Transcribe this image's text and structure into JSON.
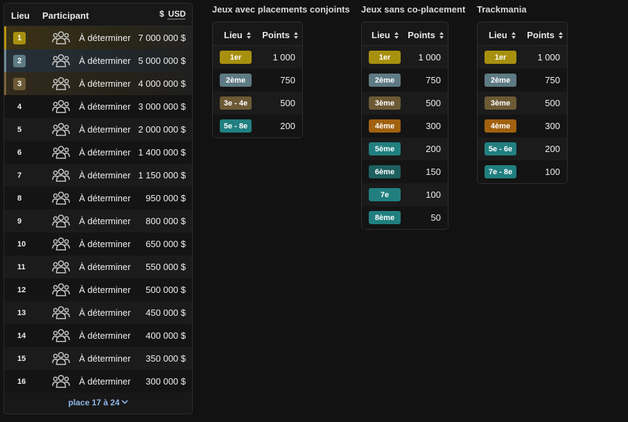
{
  "prize_table": {
    "headers": {
      "place": "Lieu",
      "participant": "Participant",
      "currency_symbol": "$",
      "currency_code": "USD"
    },
    "rows": [
      {
        "place": "1",
        "participant": "À déterminer",
        "amount": "7 000 000 $",
        "medal": "gold"
      },
      {
        "place": "2",
        "participant": "À déterminer",
        "amount": "5 000 000 $",
        "medal": "silver"
      },
      {
        "place": "3",
        "participant": "À déterminer",
        "amount": "4 000 000 $",
        "medal": "bronze"
      },
      {
        "place": "4",
        "participant": "À déterminer",
        "amount": "3 000 000 $",
        "medal": ""
      },
      {
        "place": "5",
        "participant": "À déterminer",
        "amount": "2 000 000 $",
        "medal": ""
      },
      {
        "place": "6",
        "participant": "À déterminer",
        "amount": "1 400 000 $",
        "medal": ""
      },
      {
        "place": "7",
        "participant": "À déterminer",
        "amount": "1 150 000 $",
        "medal": ""
      },
      {
        "place": "8",
        "participant": "À déterminer",
        "amount": "950 000 $",
        "medal": ""
      },
      {
        "place": "9",
        "participant": "À déterminer",
        "amount": "800 000 $",
        "medal": ""
      },
      {
        "place": "10",
        "participant": "À déterminer",
        "amount": "650 000 $",
        "medal": ""
      },
      {
        "place": "11",
        "participant": "À déterminer",
        "amount": "550 000 $",
        "medal": ""
      },
      {
        "place": "12",
        "participant": "À déterminer",
        "amount": "500 000 $",
        "medal": ""
      },
      {
        "place": "13",
        "participant": "À déterminer",
        "amount": "450 000 $",
        "medal": ""
      },
      {
        "place": "14",
        "participant": "À déterminer",
        "amount": "400 000 $",
        "medal": ""
      },
      {
        "place": "15",
        "participant": "À déterminer",
        "amount": "350 000 $",
        "medal": ""
      },
      {
        "place": "16",
        "participant": "À déterminer",
        "amount": "300 000 $",
        "medal": ""
      }
    ],
    "show_more": "place 17 à 24",
    "participant_icon": "group-icon",
    "expand_icon": "chevron-down-icon"
  },
  "points_tables": [
    {
      "title": "Jeux avec placements conjoints",
      "headers": {
        "place": "Lieu",
        "points": "Points"
      },
      "rows": [
        {
          "place": "1er",
          "points": "1 000",
          "color": "#a8900f"
        },
        {
          "place": "2ème",
          "points": "750",
          "color": "#5e7a84"
        },
        {
          "place": "3e - 4e",
          "points": "500",
          "color": "#6d5a35"
        },
        {
          "place": "5e - 8e",
          "points": "200",
          "color": "#217f80"
        }
      ]
    },
    {
      "title": "Jeux sans co-placement",
      "headers": {
        "place": "Lieu",
        "points": "Points"
      },
      "rows": [
        {
          "place": "1er",
          "points": "1 000",
          "color": "#a8900f"
        },
        {
          "place": "2ème",
          "points": "750",
          "color": "#5e7a84"
        },
        {
          "place": "3ème",
          "points": "500",
          "color": "#6d5a35"
        },
        {
          "place": "4ème",
          "points": "300",
          "color": "#a1610f"
        },
        {
          "place": "5ème",
          "points": "200",
          "color": "#217f80"
        },
        {
          "place": "6ème",
          "points": "150",
          "color": "#1e5f5f"
        },
        {
          "place": "7e",
          "points": "100",
          "color": "#217f80"
        },
        {
          "place": "8ème",
          "points": "50",
          "color": "#217f80"
        }
      ]
    },
    {
      "title": "Trackmania",
      "headers": {
        "place": "Lieu",
        "points": "Points"
      },
      "rows": [
        {
          "place": "1er",
          "points": "1 000",
          "color": "#a8900f"
        },
        {
          "place": "2ème",
          "points": "750",
          "color": "#5e7a84"
        },
        {
          "place": "3ème",
          "points": "500",
          "color": "#6d5a35"
        },
        {
          "place": "4ème",
          "points": "300",
          "color": "#a1610f"
        },
        {
          "place": "5e - 6e",
          "points": "200",
          "color": "#217f80"
        },
        {
          "place": "7e - 8e",
          "points": "100",
          "color": "#217f80"
        }
      ]
    }
  ],
  "colors": {
    "gold": "#b8960c",
    "silver": "#6f8a96",
    "bronze": "#7a6236",
    "link": "#8fb6e8"
  }
}
